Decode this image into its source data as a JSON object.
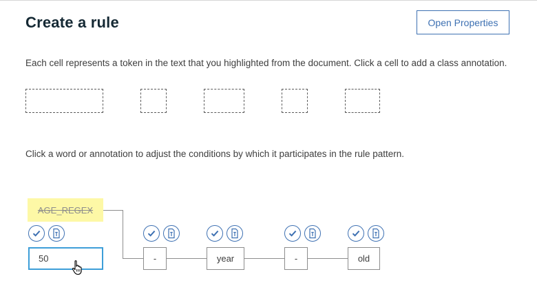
{
  "header": {
    "title": "Create a rule",
    "open_properties_label": "Open Properties"
  },
  "instructions": {
    "cells": "Each cell represents a token in the text that you highlighted from the document. Click a cell to add a class annotation.",
    "pattern": "Click a word or annotation to adjust the conditions by which it participates in the rule pattern."
  },
  "cells_count": 5,
  "pattern": {
    "annotation": {
      "label": "AGE_REGEX",
      "color": "#fdf8a6"
    },
    "tokens": [
      {
        "text": "50",
        "selected": true
      },
      {
        "text": "-",
        "selected": false
      },
      {
        "text": "year",
        "selected": false
      },
      {
        "text": "-",
        "selected": false
      },
      {
        "text": "old",
        "selected": false
      }
    ],
    "icons": {
      "check": "check-circle-icon",
      "text": "text-token-icon"
    }
  },
  "colors": {
    "accent": "#3d70b2",
    "selected_border": "#3d9ed8",
    "title": "#152934"
  }
}
